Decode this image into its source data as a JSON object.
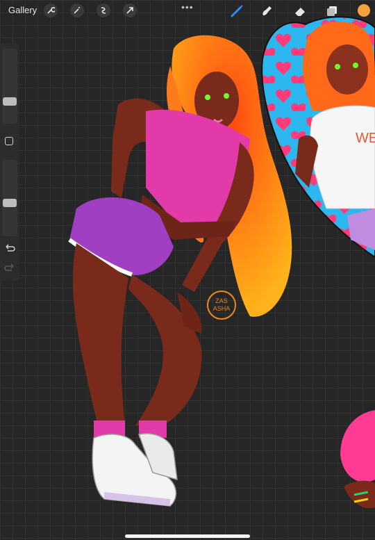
{
  "topbar": {
    "gallery_label": "Gallery",
    "more_label": "•••",
    "left_tools": [
      "wrench-icon",
      "magic-wand-icon",
      "selection-icon",
      "transform-arrow-icon"
    ],
    "right_tools": [
      "brush-icon",
      "smudge-icon",
      "eraser-icon",
      "layers-icon"
    ],
    "active_tool": "brush-icon",
    "current_color": "#f7a23a"
  },
  "sidebar": {
    "brush_size_level": 0.35,
    "opacity_level": 0.6,
    "controls": [
      "brush-size-slider",
      "modify-button",
      "opacity-slider",
      "undo-icon",
      "redo-icon"
    ]
  },
  "artwork": {
    "signature_text": "ZAS ASHA",
    "colors": {
      "skin": "#7a2a1a",
      "hair": "#ff6a1a",
      "top": "#e23aa8",
      "shorts": "#a03fc2",
      "eyes": "#6cff2a",
      "heart_bg": "#2db7ef",
      "heart_pattern": "#ff3b7a"
    }
  }
}
